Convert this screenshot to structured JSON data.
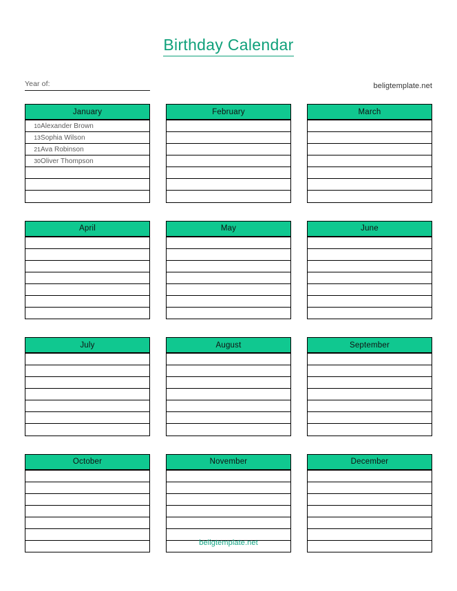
{
  "document": {
    "title": "Birthday Calendar",
    "accent_color": "#0FA07A",
    "header_fill": "#10C890"
  },
  "meta": {
    "year_label": "Year of:",
    "year_value": "",
    "site_top": "beligtemplate.net"
  },
  "footer": {
    "site_bottom": "beligtemplate.net"
  },
  "months": [
    {
      "name": "January",
      "rows": [
        {
          "date": "10",
          "name": "Alexander Brown"
        },
        {
          "date": "13",
          "name": "Sophia Wilson"
        },
        {
          "date": "21",
          "name": "Ava Robinson"
        },
        {
          "date": "30",
          "name": "Oliver Thompson"
        },
        {
          "date": "",
          "name": ""
        },
        {
          "date": "",
          "name": ""
        },
        {
          "date": "",
          "name": ""
        }
      ]
    },
    {
      "name": "February",
      "rows": [
        {
          "date": "",
          "name": ""
        },
        {
          "date": "",
          "name": ""
        },
        {
          "date": "",
          "name": ""
        },
        {
          "date": "",
          "name": ""
        },
        {
          "date": "",
          "name": ""
        },
        {
          "date": "",
          "name": ""
        },
        {
          "date": "",
          "name": ""
        }
      ]
    },
    {
      "name": "March",
      "rows": [
        {
          "date": "",
          "name": ""
        },
        {
          "date": "",
          "name": ""
        },
        {
          "date": "",
          "name": ""
        },
        {
          "date": "",
          "name": ""
        },
        {
          "date": "",
          "name": ""
        },
        {
          "date": "",
          "name": ""
        },
        {
          "date": "",
          "name": ""
        }
      ]
    },
    {
      "name": "April",
      "rows": [
        {
          "date": "",
          "name": ""
        },
        {
          "date": "",
          "name": ""
        },
        {
          "date": "",
          "name": ""
        },
        {
          "date": "",
          "name": ""
        },
        {
          "date": "",
          "name": ""
        },
        {
          "date": "",
          "name": ""
        },
        {
          "date": "",
          "name": ""
        }
      ]
    },
    {
      "name": "May",
      "rows": [
        {
          "date": "",
          "name": ""
        },
        {
          "date": "",
          "name": ""
        },
        {
          "date": "",
          "name": ""
        },
        {
          "date": "",
          "name": ""
        },
        {
          "date": "",
          "name": ""
        },
        {
          "date": "",
          "name": ""
        },
        {
          "date": "",
          "name": ""
        }
      ]
    },
    {
      "name": "June",
      "rows": [
        {
          "date": "",
          "name": ""
        },
        {
          "date": "",
          "name": ""
        },
        {
          "date": "",
          "name": ""
        },
        {
          "date": "",
          "name": ""
        },
        {
          "date": "",
          "name": ""
        },
        {
          "date": "",
          "name": ""
        },
        {
          "date": "",
          "name": ""
        }
      ]
    },
    {
      "name": "July",
      "rows": [
        {
          "date": "",
          "name": ""
        },
        {
          "date": "",
          "name": ""
        },
        {
          "date": "",
          "name": ""
        },
        {
          "date": "",
          "name": ""
        },
        {
          "date": "",
          "name": ""
        },
        {
          "date": "",
          "name": ""
        },
        {
          "date": "",
          "name": ""
        }
      ]
    },
    {
      "name": "August",
      "rows": [
        {
          "date": "",
          "name": ""
        },
        {
          "date": "",
          "name": ""
        },
        {
          "date": "",
          "name": ""
        },
        {
          "date": "",
          "name": ""
        },
        {
          "date": "",
          "name": ""
        },
        {
          "date": "",
          "name": ""
        },
        {
          "date": "",
          "name": ""
        }
      ]
    },
    {
      "name": "September",
      "rows": [
        {
          "date": "",
          "name": ""
        },
        {
          "date": "",
          "name": ""
        },
        {
          "date": "",
          "name": ""
        },
        {
          "date": "",
          "name": ""
        },
        {
          "date": "",
          "name": ""
        },
        {
          "date": "",
          "name": ""
        },
        {
          "date": "",
          "name": ""
        }
      ]
    },
    {
      "name": "October",
      "rows": [
        {
          "date": "",
          "name": ""
        },
        {
          "date": "",
          "name": ""
        },
        {
          "date": "",
          "name": ""
        },
        {
          "date": "",
          "name": ""
        },
        {
          "date": "",
          "name": ""
        },
        {
          "date": "",
          "name": ""
        },
        {
          "date": "",
          "name": ""
        }
      ]
    },
    {
      "name": "November",
      "rows": [
        {
          "date": "",
          "name": ""
        },
        {
          "date": "",
          "name": ""
        },
        {
          "date": "",
          "name": ""
        },
        {
          "date": "",
          "name": ""
        },
        {
          "date": "",
          "name": ""
        },
        {
          "date": "",
          "name": ""
        },
        {
          "date": "",
          "name": ""
        }
      ]
    },
    {
      "name": "December",
      "rows": [
        {
          "date": "",
          "name": ""
        },
        {
          "date": "",
          "name": ""
        },
        {
          "date": "",
          "name": ""
        },
        {
          "date": "",
          "name": ""
        },
        {
          "date": "",
          "name": ""
        },
        {
          "date": "",
          "name": ""
        },
        {
          "date": "",
          "name": ""
        }
      ]
    }
  ]
}
